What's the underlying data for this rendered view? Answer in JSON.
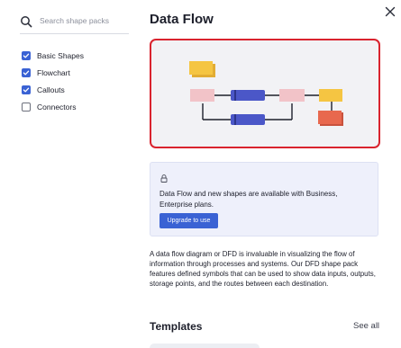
{
  "sidebar": {
    "search": {
      "placeholder": "Search shape packs",
      "value": ""
    },
    "packs": [
      {
        "label": "Basic Shapes",
        "checked": true
      },
      {
        "label": "Flowchart",
        "checked": true
      },
      {
        "label": "Callouts",
        "checked": true
      },
      {
        "label": "Connectors",
        "checked": false
      }
    ]
  },
  "main": {
    "title": "Data Flow",
    "notice": {
      "text": "Data Flow and new shapes are available with Business, Enterprise plans.",
      "button_label": "Upgrade to use"
    },
    "description": "A data flow diagram or DFD is invaluable in visualizing the flow of information through processes and systems. Our DFD shape pack features defined symbols that can be used to show data inputs, outputs, storage points, and the routes between each destination.",
    "templates": {
      "title": "Templates",
      "see_all_label": "See all"
    }
  },
  "colors": {
    "accent": "#3a62d4",
    "selection_border": "#d9232e",
    "preview_yellow": "#f5c542",
    "preview_pink": "#f2c3c8",
    "preview_blue": "#4b57c8",
    "preview_orange": "#e8684e"
  },
  "icons": {
    "search": "search-icon",
    "close": "close-icon",
    "lock": "lock-icon",
    "check": "check-icon"
  }
}
